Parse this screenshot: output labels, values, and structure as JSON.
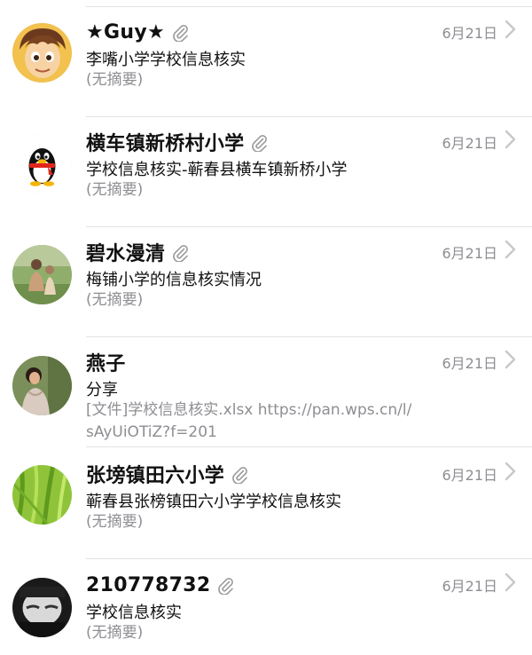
{
  "messages": [
    {
      "sender": "★Guy★",
      "has_attachment": true,
      "date": "6月21日",
      "subject": "李嘴小学学校信息核实",
      "preview": [
        "(无摘要)"
      ],
      "avatar": "cartoon-boy-avatar"
    },
    {
      "sender": "横车镇新桥村小学",
      "has_attachment": true,
      "date": "6月21日",
      "subject": "学校信息核实-蕲春县横车镇新桥小学",
      "preview": [
        "(无摘要)"
      ],
      "avatar": "qq-penguin-avatar"
    },
    {
      "sender": "碧水漫清",
      "has_attachment": true,
      "date": "6月21日",
      "subject": "梅铺小学的信息核实情况",
      "preview": [
        "(无摘要)"
      ],
      "avatar": "outdoor-photo-avatar"
    },
    {
      "sender": "燕子",
      "has_attachment": false,
      "date": "6月21日",
      "subject": "分享",
      "preview": [
        "[文件]学校信息核实.xlsx https://pan.wps.cn/l/",
        "sAyUiOTiZ?f=201"
      ],
      "avatar": "woman-photo-avatar"
    },
    {
      "sender": "张塝镇田六小学",
      "has_attachment": true,
      "date": "6月21日",
      "subject": "蕲春县张榜镇田六小学学校信息核实",
      "preview": [
        "(无摘要)"
      ],
      "avatar": "green-grass-avatar"
    },
    {
      "sender": "210778732",
      "has_attachment": true,
      "date": "6月21日",
      "subject": "学校信息核实",
      "preview": [
        "(无摘要)"
      ],
      "avatar": "dark-face-avatar"
    }
  ],
  "colors": {
    "primary_text": "#111111",
    "secondary_text": "#8e8e93",
    "divider": "#e3e3e3",
    "chevron": "#c7c7cc"
  }
}
